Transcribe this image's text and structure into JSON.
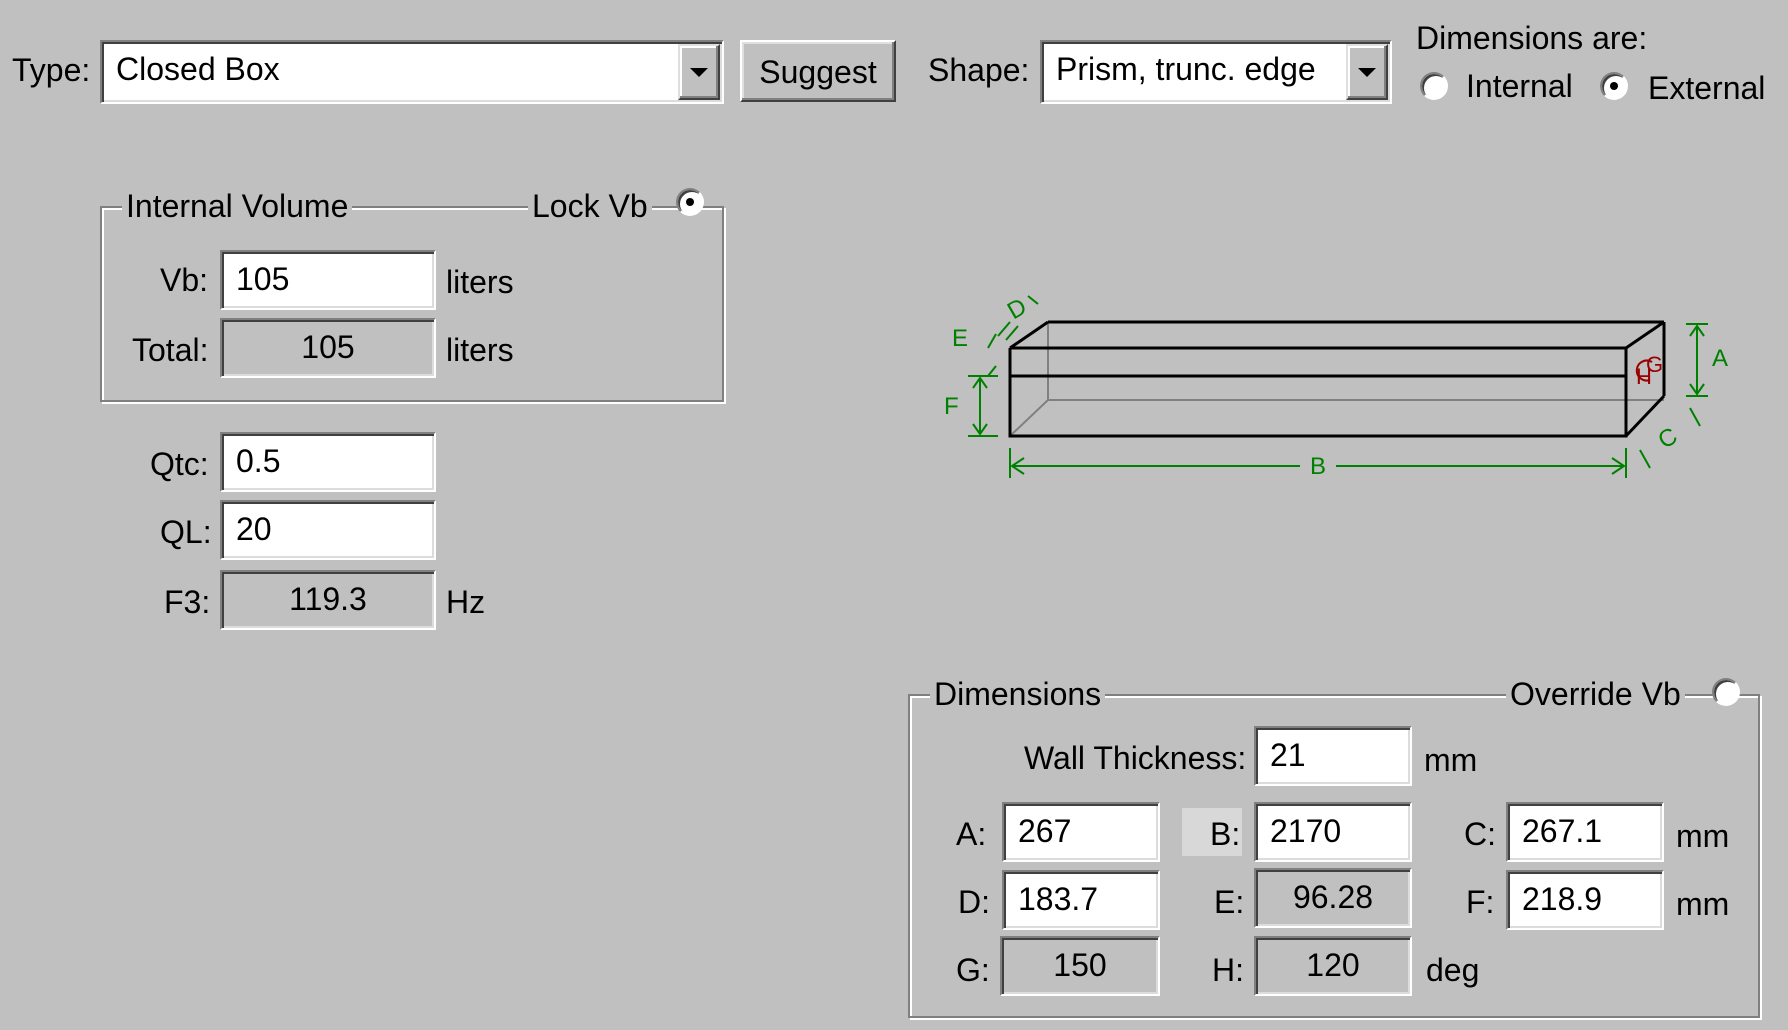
{
  "top": {
    "type_label": "Type:",
    "type_value": "Closed Box",
    "suggest_label": "Suggest",
    "shape_label": "Shape:",
    "shape_value": "Prism, trunc. edge",
    "dimensions_are_label": "Dimensions are:",
    "internal_label": "Internal",
    "external_label": "External",
    "dimensions_are_selected": "External"
  },
  "internal_volume": {
    "title": "Internal Volume",
    "lock_label": "Lock Vb",
    "lock_vb_checked": true,
    "vb_label": "Vb:",
    "vb_value": "105",
    "vb_unit": "liters",
    "total_label": "Total:",
    "total_value": "105",
    "total_unit": "liters"
  },
  "params": {
    "qtc_label": "Qtc:",
    "qtc_value": "0.5",
    "ql_label": "QL:",
    "ql_value": "20",
    "f3_label": "F3:",
    "f3_value": "119.3",
    "f3_unit": "Hz"
  },
  "diagram": {
    "labels": {
      "a": "A",
      "b": "B",
      "c": "C",
      "d": "D",
      "e": "E",
      "f": "F",
      "g": "G",
      "h": "H"
    },
    "color_dimension": "#008000",
    "color_angle": "#990000"
  },
  "dimensions": {
    "title": "Dimensions",
    "override_label": "Override Vb",
    "override_vb_checked": false,
    "wall_label": "Wall Thickness:",
    "wall_value": "21",
    "wall_unit": "mm",
    "a_label": "A:",
    "a_value": "267",
    "b_label": "B:",
    "b_value": "2170",
    "c_label": "C:",
    "c_value": "267.1",
    "row1_unit": "mm",
    "d_label": "D:",
    "d_value": "183.7",
    "e_label": "E:",
    "e_value": "96.28",
    "f_label": "F:",
    "f_value": "218.9",
    "row2_unit": "mm",
    "g_label": "G:",
    "g_value": "150",
    "h_label": "H:",
    "h_value": "120",
    "row3_unit": "deg"
  }
}
